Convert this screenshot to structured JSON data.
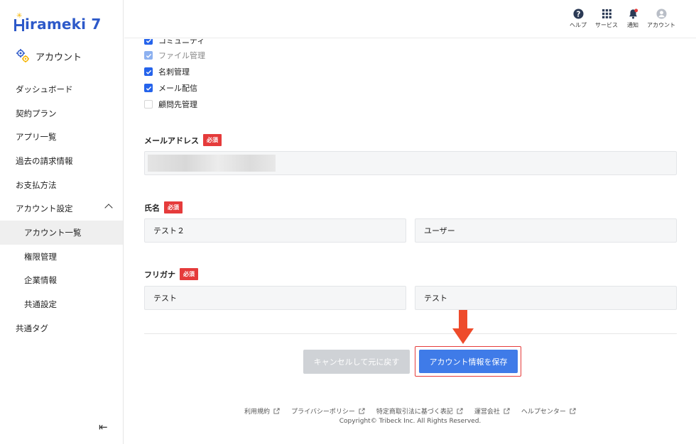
{
  "brand": {
    "logo_text": "irameki 7",
    "logo_color": "#2d59c9"
  },
  "sidebar": {
    "section_title": "アカウント",
    "items": [
      {
        "label": "ダッシュボード"
      },
      {
        "label": "契約プラン"
      },
      {
        "label": "アプリ一覧"
      },
      {
        "label": "過去の請求情報"
      },
      {
        "label": "お支払方法"
      },
      {
        "label": "アカウント設定",
        "expanded": true
      },
      {
        "label": "アカウント一覧",
        "active": true
      },
      {
        "label": "権限管理"
      },
      {
        "label": "企業情報"
      },
      {
        "label": "共通設定"
      },
      {
        "label": "共通タグ"
      }
    ],
    "collapse_icon": "collapse-left-icon"
  },
  "header": {
    "help": "ヘルプ",
    "services": "サービス",
    "notifications": "通知",
    "account": "アカウント"
  },
  "permissions": [
    {
      "label": "コミュニティ",
      "checked": true,
      "disabled": false
    },
    {
      "label": "ファイル管理",
      "checked": true,
      "disabled": true
    },
    {
      "label": "名刺管理",
      "checked": true,
      "disabled": false
    },
    {
      "label": "メール配信",
      "checked": true,
      "disabled": false
    },
    {
      "label": "顧問先管理",
      "checked": false,
      "disabled": false
    }
  ],
  "form": {
    "required_badge": "必須",
    "email": {
      "label": "メールアドレス",
      "value": ""
    },
    "name": {
      "label": "氏名",
      "last": "テスト２",
      "first": "ユーザー"
    },
    "kana": {
      "label": "フリガナ",
      "last": "テスト",
      "first": "テスト"
    }
  },
  "actions": {
    "cancel": "キャンセルして元に戻す",
    "save": "アカウント情報を保存"
  },
  "footer": {
    "links": [
      "利用規約",
      "プライバシーポリシー",
      "特定商取引法に基づく表記",
      "運営会社",
      "ヘルプセンター"
    ],
    "copyright": "Copyright© Tribeck Inc. All Rights Reserved."
  },
  "colors": {
    "primary": "#3f7be8",
    "required": "#e53b3b",
    "highlight": "#e53b3b"
  }
}
